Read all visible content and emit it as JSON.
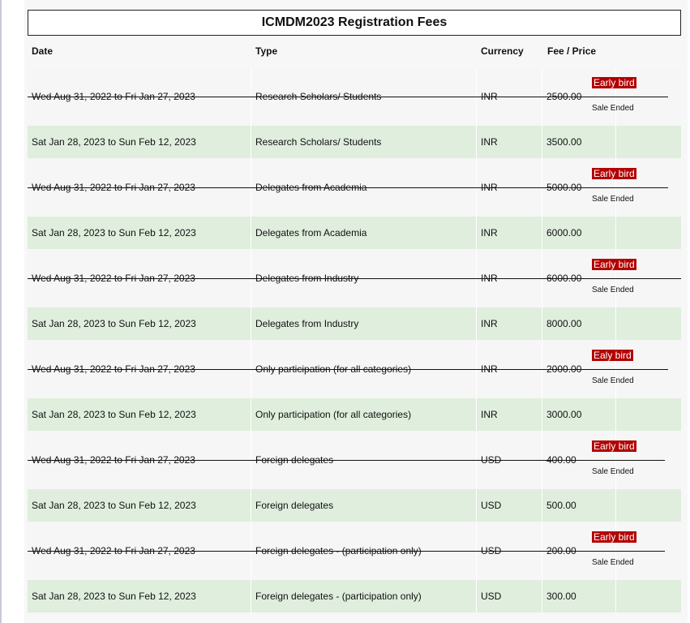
{
  "title": "ICMDM2023 Registration Fees",
  "headers": {
    "date": "Date",
    "type": "Type",
    "currency": "Currency",
    "fee": "Fee / Price"
  },
  "rows": [
    {
      "date": "Wed Aug 31, 2022 to Fri Jan 27, 2023",
      "type": "Research Scholars/ Students",
      "currency": "INR",
      "fee": "2500.00",
      "badge": "Early bird",
      "status": "Sale Ended",
      "ended": true
    },
    {
      "date": "Sat Jan 28, 2023 to Sun Feb 12, 2023",
      "type": "Research Scholars/ Students",
      "currency": "INR",
      "fee": "3500.00",
      "badge": "",
      "status": "",
      "ended": false
    },
    {
      "date": "Wed Aug 31, 2022 to Fri Jan 27, 2023",
      "type": "Delegates from Academia",
      "currency": "INR",
      "fee": "5000.00",
      "badge": "Early bird",
      "status": "Sale Ended",
      "ended": true
    },
    {
      "date": "Sat Jan 28, 2023 to Sun Feb 12, 2023",
      "type": "Delegates from Academia",
      "currency": "INR",
      "fee": "6000.00",
      "badge": "",
      "status": "",
      "ended": false
    },
    {
      "date": "Wed Aug 31, 2022 to Fri Jan 27, 2023",
      "type": "Delegates from Industry",
      "currency": "INR",
      "fee": "6000.00",
      "badge": "Early bird",
      "status": "Sale Ended",
      "ended": true
    },
    {
      "date": "Sat Jan 28, 2023 to Sun Feb 12, 2023",
      "type": "Delegates from Industry",
      "currency": "INR",
      "fee": "8000.00",
      "badge": "",
      "status": "",
      "ended": false
    },
    {
      "date": "Wed Aug 31, 2022 to Fri Jan 27, 2023",
      "type": "Only participation (for all categories)",
      "currency": "INR",
      "fee": "2000.00",
      "badge": "Ealy bird",
      "status": "Sale Ended",
      "ended": true
    },
    {
      "date": "Sat Jan 28, 2023 to Sun Feb 12, 2023",
      "type": "Only participation (for all categories)",
      "currency": "INR",
      "fee": "3000.00",
      "badge": "",
      "status": "",
      "ended": false
    },
    {
      "date": "Wed Aug 31, 2022 to Fri Jan 27, 2023",
      "type": "Foreign delegates",
      "currency": "USD",
      "fee": "400.00",
      "badge": "Early bird",
      "status": "Sale Ended",
      "ended": true
    },
    {
      "date": "Sat Jan 28, 2023 to Sun Feb 12, 2023",
      "type": "Foreign delegates",
      "currency": "USD",
      "fee": "500.00",
      "badge": "",
      "status": "",
      "ended": false
    },
    {
      "date": "Wed Aug 31, 2022 to Fri Jan 27, 2023",
      "type": "Foreign delegates - (participation only)",
      "currency": "USD",
      "fee": "200.00",
      "badge": "Early bird",
      "status": "Sale Ended",
      "ended": true
    },
    {
      "date": "Sat Jan 28, 2023 to Sun Feb 12, 2023",
      "type": "Foreign delegates - (participation only)",
      "currency": "USD",
      "fee": "300.00",
      "badge": "",
      "status": "",
      "ended": false
    }
  ],
  "colors": {
    "active_row": "#dfeedd",
    "ended_row": "#f6f6f6",
    "badge_bg": "#b30000"
  }
}
